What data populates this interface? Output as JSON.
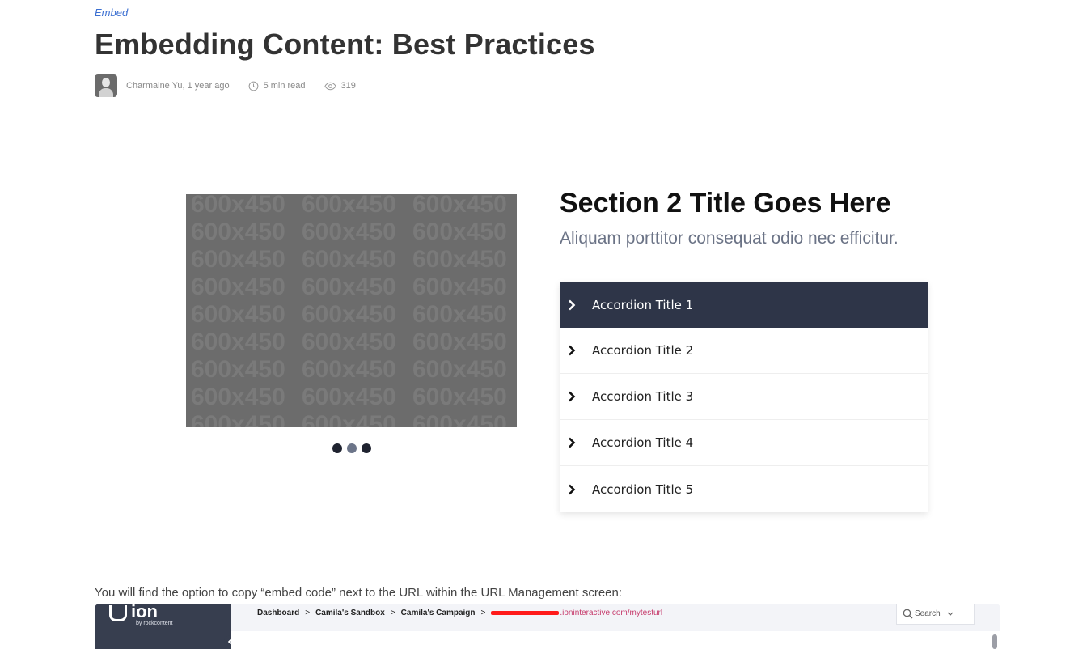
{
  "article": {
    "category": "Embed",
    "title": "Embedding Content: Best Practices",
    "author": "Charmaine Yu,",
    "posted": "1 year ago",
    "read_time": "5 min read",
    "views": "319"
  },
  "carousel": {
    "placeholder_text": "600x450",
    "slide_count": 3,
    "active_slide": 2
  },
  "section": {
    "title": "Section 2 Title Goes Here",
    "subtitle": "Aliquam porttitor consequat odio nec efficitur."
  },
  "accordion": {
    "items": [
      {
        "label": "Accordion Title 1",
        "open": true
      },
      {
        "label": "Accordion Title 2",
        "open": false
      },
      {
        "label": "Accordion Title 3",
        "open": false
      },
      {
        "label": "Accordion Title 4",
        "open": false
      },
      {
        "label": "Accordion Title 5",
        "open": false
      }
    ]
  },
  "body_text": "You will find the option to copy “embed code” next to the URL within the URL Management screen:",
  "screenshot": {
    "logo": "ion",
    "logo_by": "by rockcontent",
    "breadcrumbs": [
      "Dashboard",
      ">",
      "Camila's Sandbox",
      ">",
      "Camila's Campaign",
      ">"
    ],
    "url_visible": ".ioninteractive.com/mytesturl",
    "search_label": "Search"
  },
  "colors": {
    "accent": "#3b6fd1",
    "accordion_open_bg": "#2e3548",
    "url_color": "#c63a6b",
    "redaction": "#ff1a1a"
  }
}
